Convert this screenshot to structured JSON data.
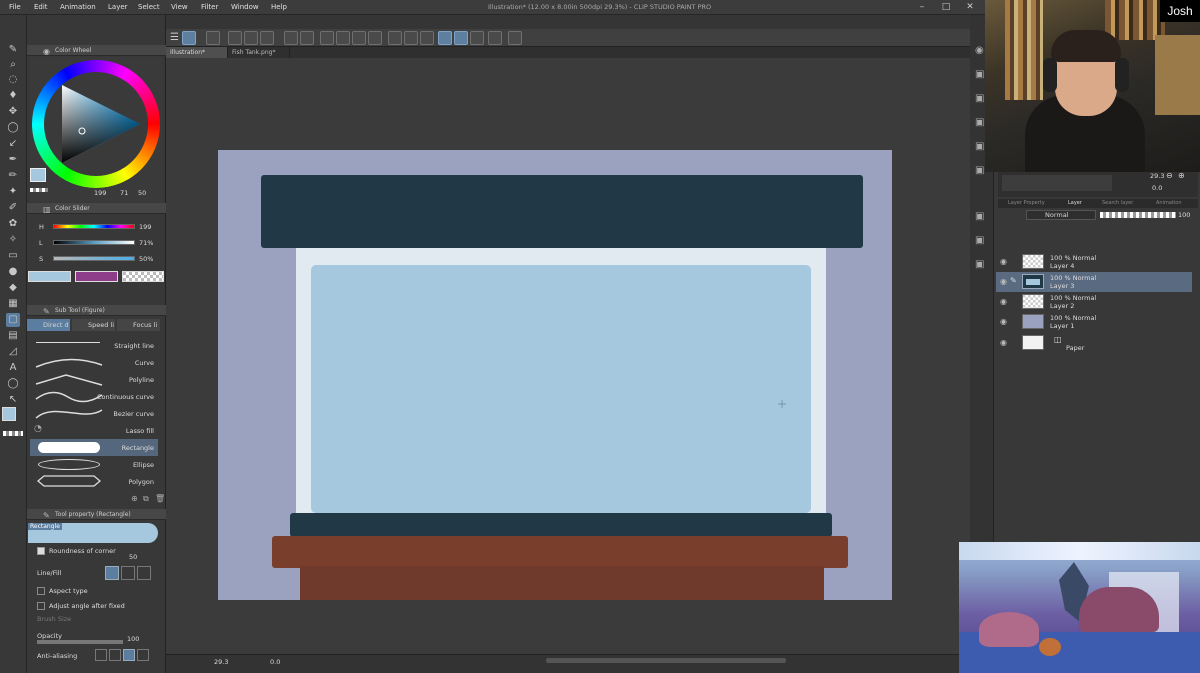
{
  "menu": [
    "File",
    "Edit",
    "Animation",
    "Layer",
    "Select",
    "View",
    "Filter",
    "Window",
    "Help"
  ],
  "app_title": "Illustration* (12.00 x 8.00in 500dpi 29.3%) - CLIP STUDIO PAINT PRO",
  "doc_tabs": [
    {
      "label": "Illustration*",
      "active": true
    },
    {
      "label": "Fish Tank.png*",
      "active": false
    }
  ],
  "color_wheel": {
    "title": "Color Wheel",
    "h": "199",
    "s": "71",
    "v": "50"
  },
  "color_slider": {
    "title": "Color Slider",
    "rows": [
      {
        "label": "H",
        "value": "199"
      },
      {
        "label": "L",
        "value": "71%"
      },
      {
        "label": "S",
        "value": "50%"
      }
    ],
    "swatches": [
      "#a6c8de",
      "#8e3d8b",
      "checker"
    ]
  },
  "sub_tool": {
    "title": "Sub Tool (Figure)",
    "tabs": [
      "Direct d",
      "Speed li",
      "Focus li"
    ],
    "items": [
      "Straight line",
      "Curve",
      "Polyline",
      "Continuous curve",
      "Bezier curve",
      "Lasso fill",
      "Rectangle",
      "Ellipse",
      "Polygon"
    ],
    "selected": "Rectangle"
  },
  "tool_property": {
    "title": "Tool property (Rectangle)",
    "tool_name": "Rectangle",
    "roundness_label": "Roundness of corner",
    "roundness_value": "50",
    "line_fill_label": "Line/Fill",
    "aspect_type_label": "Aspect type",
    "adjust_angle_label": "Adjust angle after fixed",
    "brush_size_label": "Brush Size",
    "opacity_label": "Opacity",
    "opacity_value": "100",
    "anti_aliasing_label": "Anti-aliasing"
  },
  "statusbar": {
    "zoom": "29.3",
    "angle": "0.0"
  },
  "navigator": {
    "zoom": "29.3",
    "angle": "0.0"
  },
  "layer_panel": {
    "tabs": [
      "Layer Property",
      "Layer",
      "Search layer",
      "Animation"
    ],
    "blend_mode": "Normal",
    "opacity": "100",
    "layers": [
      {
        "mode": "100 % Normal",
        "name": "Layer 4",
        "selected": false
      },
      {
        "mode": "100 % Normal",
        "name": "Layer 3",
        "selected": true
      },
      {
        "mode": "100 % Normal",
        "name": "Layer 2",
        "selected": false
      },
      {
        "mode": "100 % Normal",
        "name": "Layer 1",
        "selected": false
      },
      {
        "mode": "",
        "name": "Paper",
        "selected": false
      }
    ]
  },
  "streamer": {
    "name": "Josh"
  },
  "colors": {
    "canvas_bg": "#9aa2c0",
    "tank_lid": "#213846",
    "tank_frame": "#e0eaf0",
    "tank_water": "#a6c8de",
    "tank_base": "#213846",
    "stand_top": "#7a3e2d",
    "stand_body": "#6f3a2b",
    "accent": "#5b7da0"
  }
}
